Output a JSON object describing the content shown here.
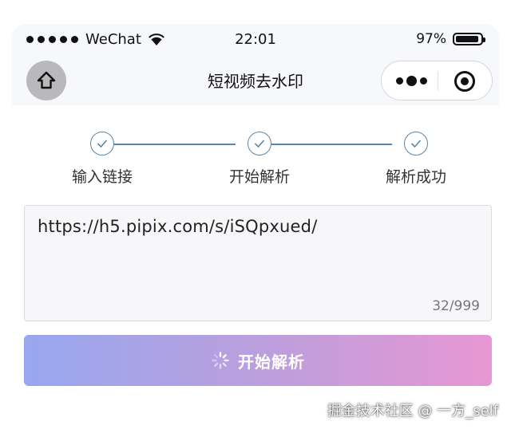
{
  "status_bar": {
    "carrier": "WeChat",
    "time": "22:01",
    "battery": "97%",
    "battery_level": 0.97,
    "signal_dots": 5
  },
  "nav": {
    "title": "短视频去水印",
    "home_icon": "home-icon",
    "more_icon": "more-dots-icon",
    "close_icon": "record-circle-icon"
  },
  "steps": [
    {
      "label": "输入链接",
      "icon": "check-icon"
    },
    {
      "label": "开始解析",
      "icon": "check-icon"
    },
    {
      "label": "解析成功",
      "icon": "check-icon"
    }
  ],
  "input": {
    "value": "https://h5.pipix.com/s/iSQpxued/",
    "counter": "32/999"
  },
  "button": {
    "label": "开始解析",
    "icon": "spinner-icon"
  },
  "watermark": "掘金技术社区 @ 一方_self",
  "colors": {
    "step_accent": "#5a86a8",
    "button_gradient_start": "#97a7ef",
    "button_gradient_end": "#e797d3"
  }
}
